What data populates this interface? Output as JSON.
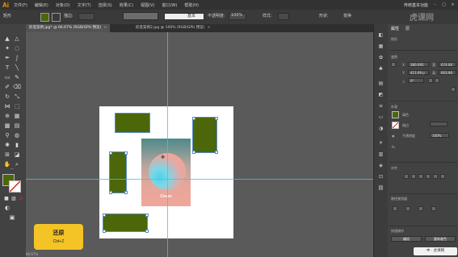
{
  "menubar": {
    "logo": "Ai",
    "items": [
      "文件(F)",
      "编辑(E)",
      "对象(O)",
      "文字(T)",
      "选择(S)",
      "效果(C)",
      "视图(V)",
      "窗口(W)",
      "帮助(H)"
    ],
    "workspace": "传统基本功能"
  },
  "controlbar": {
    "object_label": "矩形",
    "stroke_label": "描边:",
    "stroke_style": "基本",
    "opacity_label": "不透明度:",
    "opacity_value": "100%",
    "style_label": "样式:",
    "shape_label": "形状:",
    "transform_label": "变换",
    "fill_color": "#4b6709"
  },
  "tabs": [
    {
      "label": "形变案例.jpg* @ 66.67% (RGB/GPU 预览)",
      "active": true
    },
    {
      "label": "形变案例2.jpg @ 100% (RGB/GPU 预览)",
      "active": false
    }
  ],
  "canvas": {
    "cover_title": "Cover",
    "status_zoom": "66.67%"
  },
  "undo_tip": {
    "title": "还原",
    "shortcut": "Ctrl+Z"
  },
  "panel": {
    "tabs": [
      "属性",
      "层"
    ],
    "section_shape": "矩形",
    "section_transform": "变换",
    "x_label": "X:",
    "x_value": "380.092",
    "y_label": "Y:",
    "y_value": "411.69 p",
    "w_label": "宽:",
    "w_value": "674.06",
    "h_label": "高:",
    "h_value": "603.96",
    "angle_value": "0°",
    "section_appearance": "外观",
    "fill_label": "填色",
    "stroke_label": "描边",
    "opacity_label": "不透明度",
    "opacity_value": "100%",
    "fx_label": "fx.",
    "section_align": "对齐",
    "section_pathfinder": "路径查找器",
    "section_quick": "快速操作",
    "btn_edit": "编组",
    "btn_recolor": "重新着色"
  },
  "watermark": "虎课网",
  "brand": "中 · 虎课网"
}
